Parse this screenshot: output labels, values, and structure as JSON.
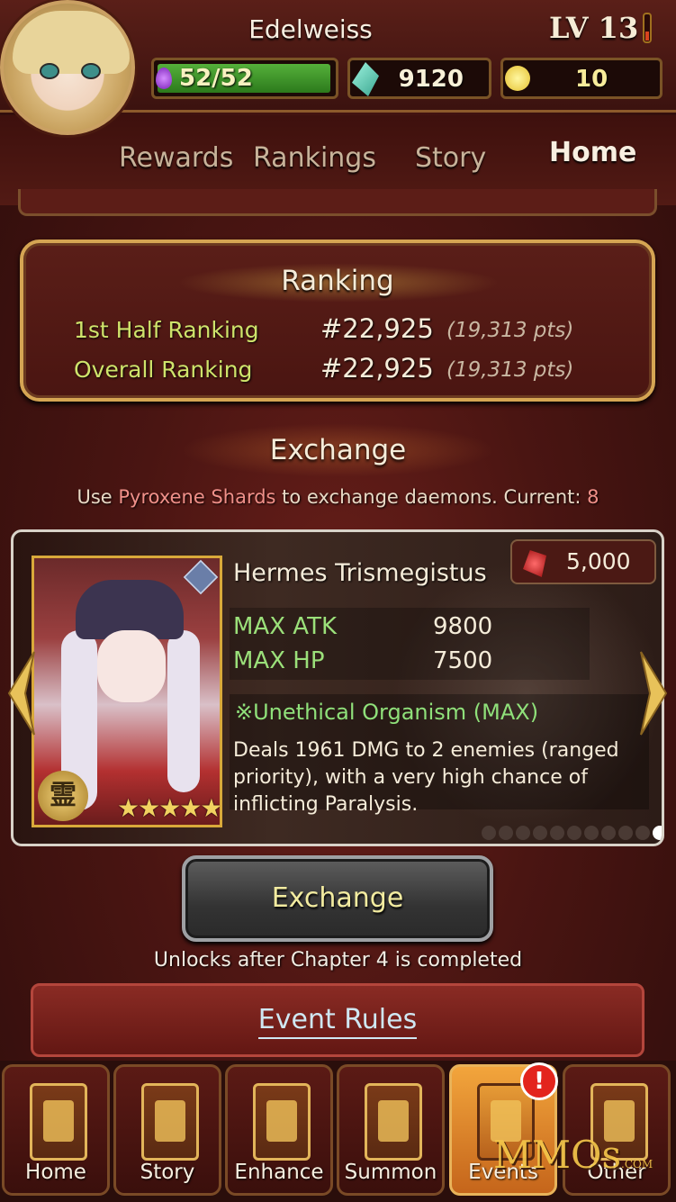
{
  "player": {
    "name": "Edelweiss",
    "level_label": "LV 13",
    "stamina": "52/52",
    "crystals": "9120",
    "gold": "10"
  },
  "tabs": [
    {
      "label": "Rewards"
    },
    {
      "label": "Rankings"
    },
    {
      "label": "Story"
    },
    {
      "label": "Home",
      "active": true
    }
  ],
  "ranking": {
    "title": "Ranking",
    "rows": [
      {
        "label": "1st Half Ranking",
        "value": "#22,925",
        "pts": "(19,313 pts)"
      },
      {
        "label": "Overall Ranking",
        "value": "#22,925",
        "pts": "(19,313 pts)"
      }
    ]
  },
  "exchange": {
    "title": "Exchange",
    "desc_prefix": "Use ",
    "desc_highlight": "Pyroxene Shards",
    "desc_middle": " to exchange daemons. Current: ",
    "desc_current": "8",
    "button_label": "Exchange",
    "unlock_note": "Unlocks after Chapter 4 is completed"
  },
  "daemon": {
    "name": "Hermes Trismegistus",
    "cost": "5,000",
    "stats": [
      {
        "label": "MAX ATK",
        "value": "9800"
      },
      {
        "label": "MAX HP",
        "value": "7500"
      }
    ],
    "skill_name": "※Unethical Organism (MAX)",
    "skill_desc": "Deals 1961 DMG to 2 enemies (ranged priority), with a very high chance of inflicting Paralysis.",
    "spirit_glyph": "霊",
    "stars": "★★★★★",
    "page_dots": 12,
    "active_dot": 10
  },
  "event_rules_label": "Event Rules",
  "nav": [
    {
      "label": "Home",
      "icon": "home-icon"
    },
    {
      "label": "Story",
      "icon": "story-icon"
    },
    {
      "label": "Enhance",
      "icon": "enhance-icon"
    },
    {
      "label": "Summon",
      "icon": "summon-icon"
    },
    {
      "label": "Events",
      "icon": "events-icon",
      "active": true
    },
    {
      "label": "Other",
      "icon": "other-icon"
    }
  ],
  "events_badge": "!",
  "watermark": "MMOs",
  "watermark_suffix": ".COM",
  "colors": {
    "accent_gold": "#d5a553",
    "stat_green": "#9be07a",
    "highlight_pink": "#f09089",
    "active_tab_orange": "#f2a53c"
  }
}
